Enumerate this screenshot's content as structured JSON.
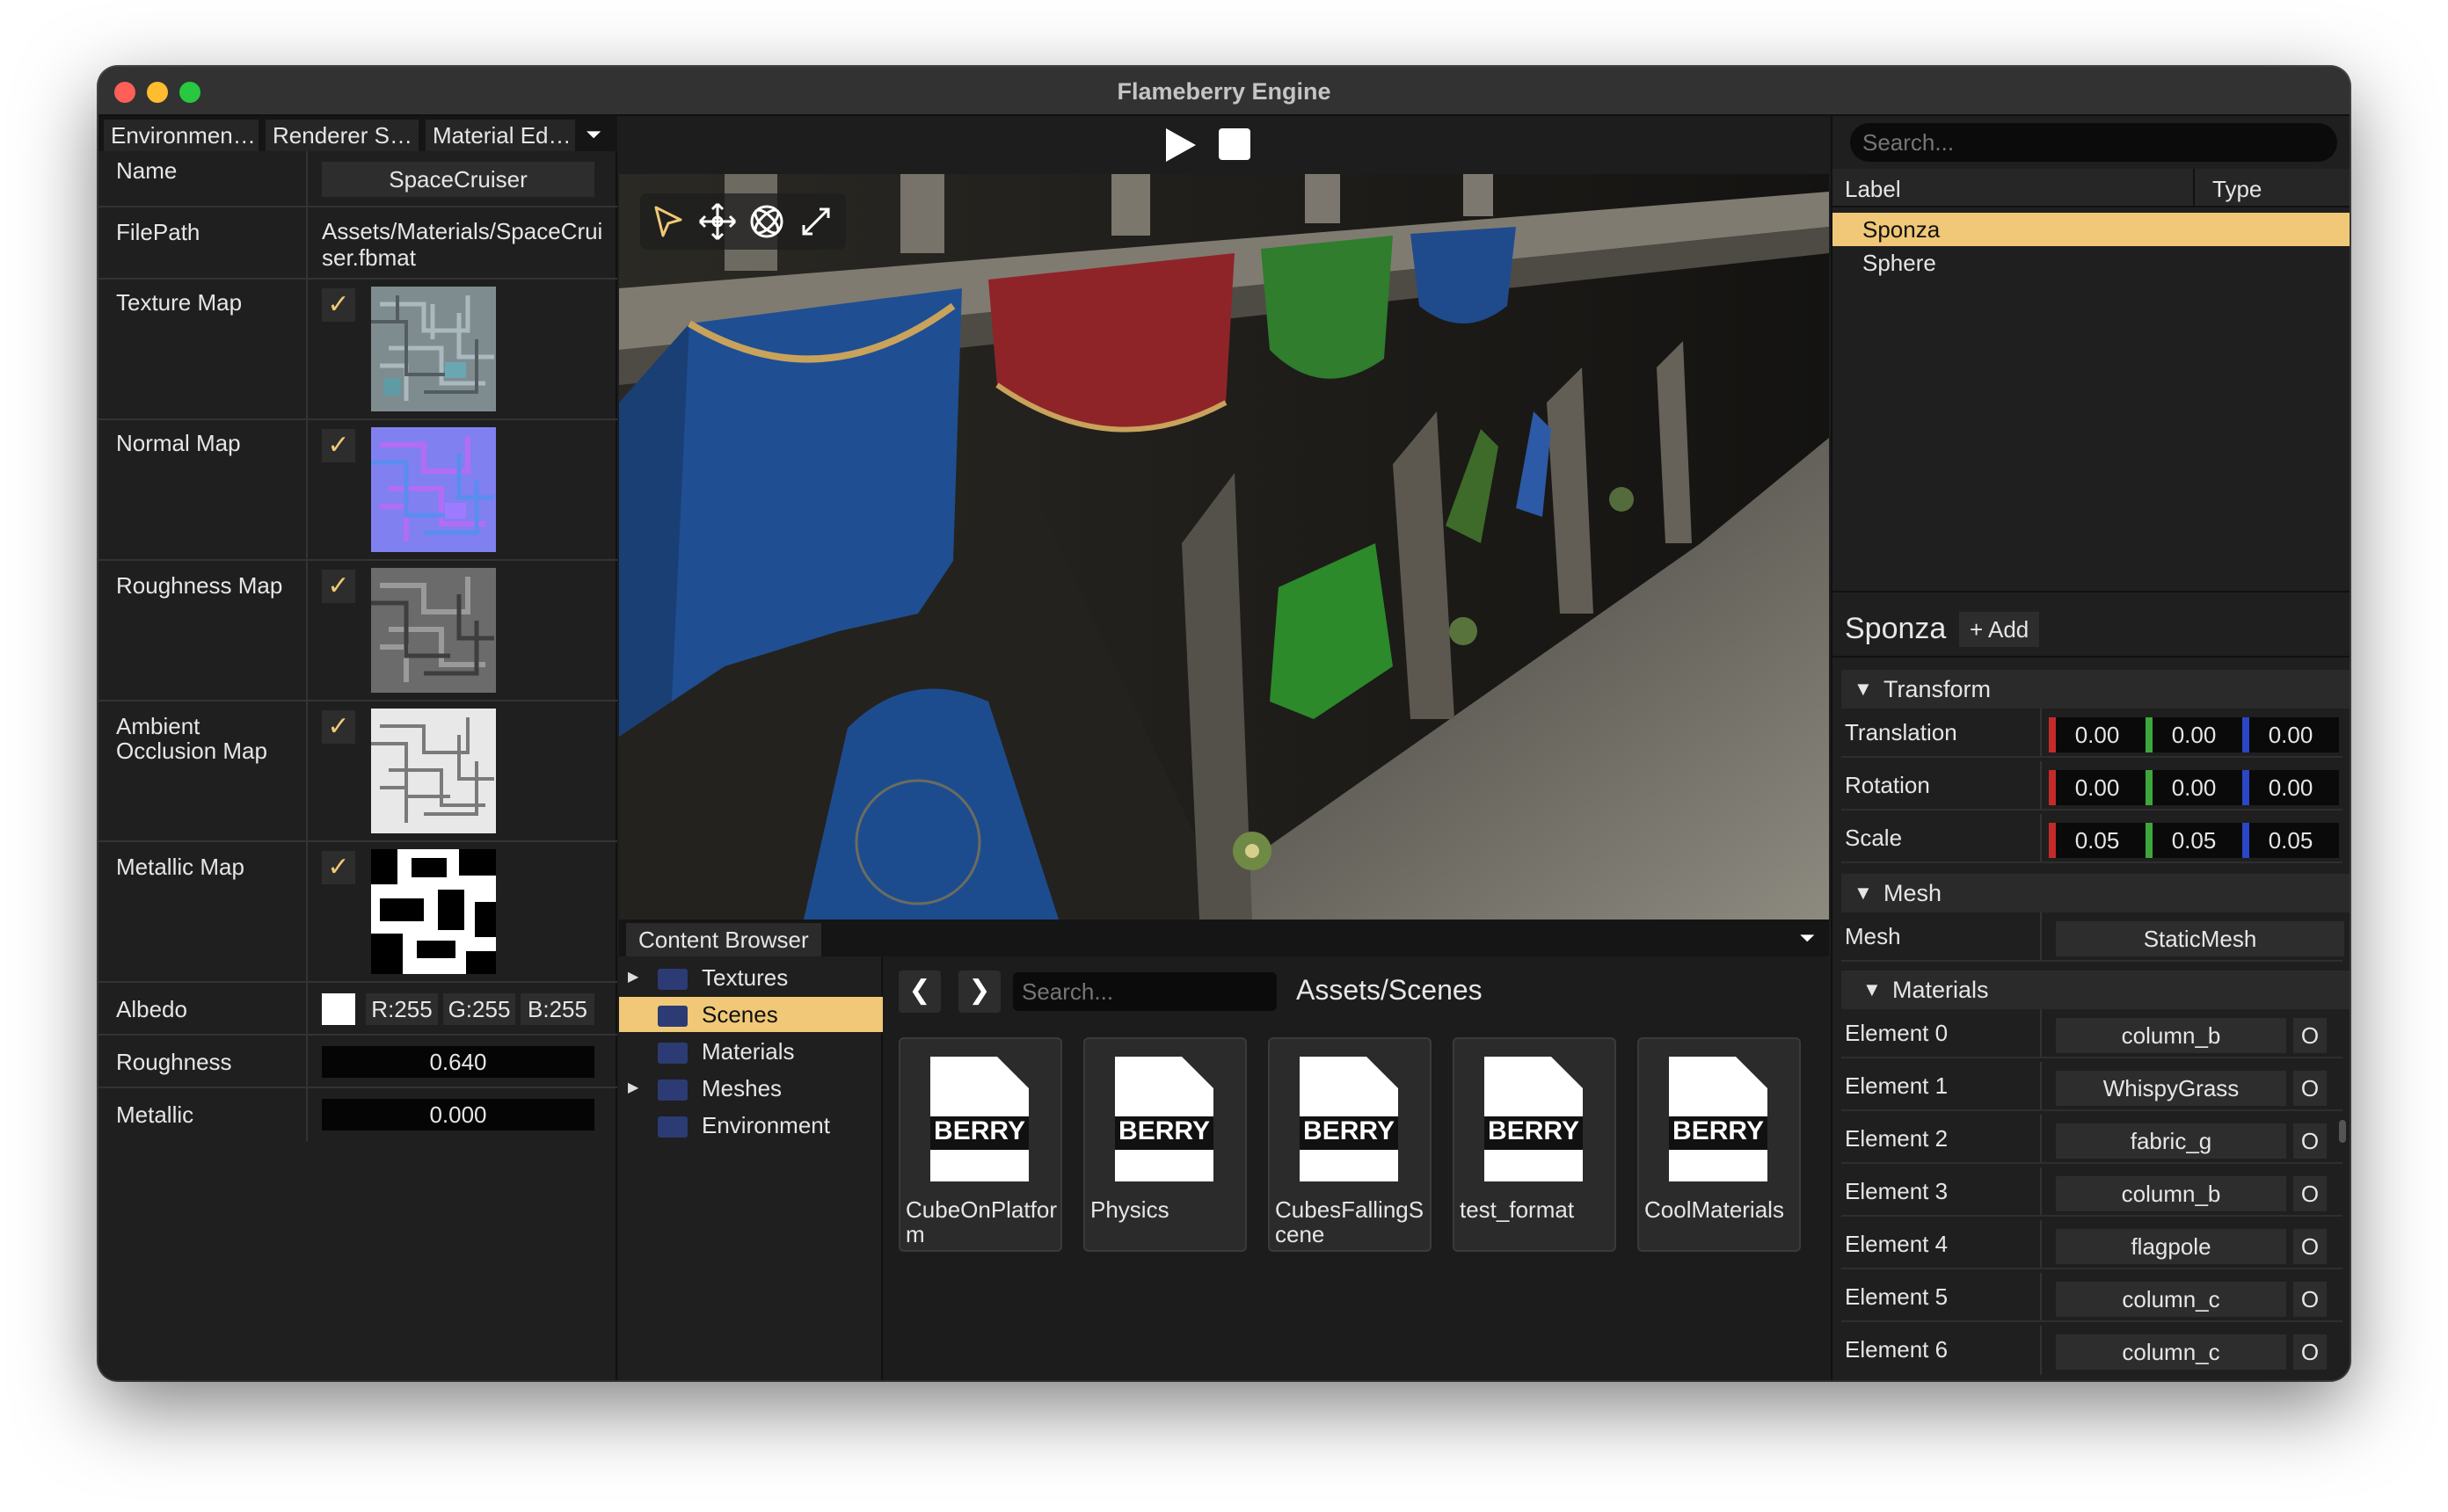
{
  "window": {
    "title": "Flameberry Engine"
  },
  "left_panel": {
    "tabs": [
      "Environmen…",
      "Renderer S…",
      "Material Ed…"
    ],
    "name": {
      "label": "Name",
      "value": "SpaceCruiser"
    },
    "filepath": {
      "label": "FilePath",
      "value": "Assets/Materials/SpaceCruiser.fbmat"
    },
    "maps": [
      {
        "label": "Texture Map",
        "enabled": true,
        "check": "✓"
      },
      {
        "label": "Normal Map",
        "enabled": true,
        "check": "✓"
      },
      {
        "label": "Roughness Map",
        "enabled": true,
        "check": "✓"
      },
      {
        "label": "Ambient Occlusion Map",
        "enabled": true,
        "check": "✓"
      },
      {
        "label": "Metallic Map",
        "enabled": true,
        "check": "✓"
      }
    ],
    "albedo": {
      "label": "Albedo",
      "r": "R:255",
      "g": "G:255",
      "b": "B:255",
      "color": "#ffffff"
    },
    "roughness": {
      "label": "Roughness",
      "value": "0.640"
    },
    "metallic": {
      "label": "Metallic",
      "value": "0.000"
    }
  },
  "toolbar": {
    "play_icon": "play-icon",
    "stop_icon": "stop-icon"
  },
  "viewport": {
    "gizmos": [
      "select-icon",
      "move-icon",
      "rotate-icon",
      "scale-icon"
    ]
  },
  "content_browser": {
    "tab_label": "Content Browser",
    "tree": [
      {
        "label": "Textures",
        "expandable": true,
        "selected": false
      },
      {
        "label": "Scenes",
        "expandable": false,
        "selected": true
      },
      {
        "label": "Materials",
        "expandable": false,
        "selected": false
      },
      {
        "label": "Meshes",
        "expandable": true,
        "selected": false
      },
      {
        "label": "Environment",
        "expandable": false,
        "selected": false
      }
    ],
    "back_icon": "❮",
    "forward_icon": "❯",
    "search_placeholder": "Search...",
    "path": "Assets/Scenes",
    "file_badge": "BERRY",
    "files": [
      "CubeOnPlatform",
      "Physics",
      "CubesFallingScene",
      "test_format",
      "CoolMaterials"
    ]
  },
  "scene_hierarchy": {
    "search_placeholder": "Search...",
    "columns": [
      "Label",
      "Type"
    ],
    "entities": [
      {
        "label": "Sponza",
        "selected": true
      },
      {
        "label": "Sphere",
        "selected": false
      }
    ]
  },
  "inspector": {
    "entity_name": "Sponza",
    "add_label": "+ Add",
    "transform": {
      "title": "Transform",
      "rows": [
        {
          "label": "Translation",
          "x": "0.00",
          "y": "0.00",
          "z": "0.00"
        },
        {
          "label": "Rotation",
          "x": "0.00",
          "y": "0.00",
          "z": "0.00"
        },
        {
          "label": "Scale",
          "x": "0.05",
          "y": "0.05",
          "z": "0.05"
        }
      ]
    },
    "mesh": {
      "title": "Mesh",
      "label": "Mesh",
      "value": "StaticMesh"
    },
    "materials": {
      "title": "Materials",
      "open_label": "O",
      "elements": [
        {
          "label": "Element 0",
          "value": "column_b"
        },
        {
          "label": "Element 1",
          "value": "WhispyGrass"
        },
        {
          "label": "Element 2",
          "value": "fabric_g"
        },
        {
          "label": "Element 3",
          "value": "column_b"
        },
        {
          "label": "Element 4",
          "value": "flagpole"
        },
        {
          "label": "Element 5",
          "value": "column_c"
        },
        {
          "label": "Element 6",
          "value": "column_c"
        }
      ]
    }
  },
  "colors": {
    "accent": "#f0c877",
    "x_axis": "#c42a2a",
    "y_axis": "#3da83a",
    "z_axis": "#2b46c6"
  }
}
